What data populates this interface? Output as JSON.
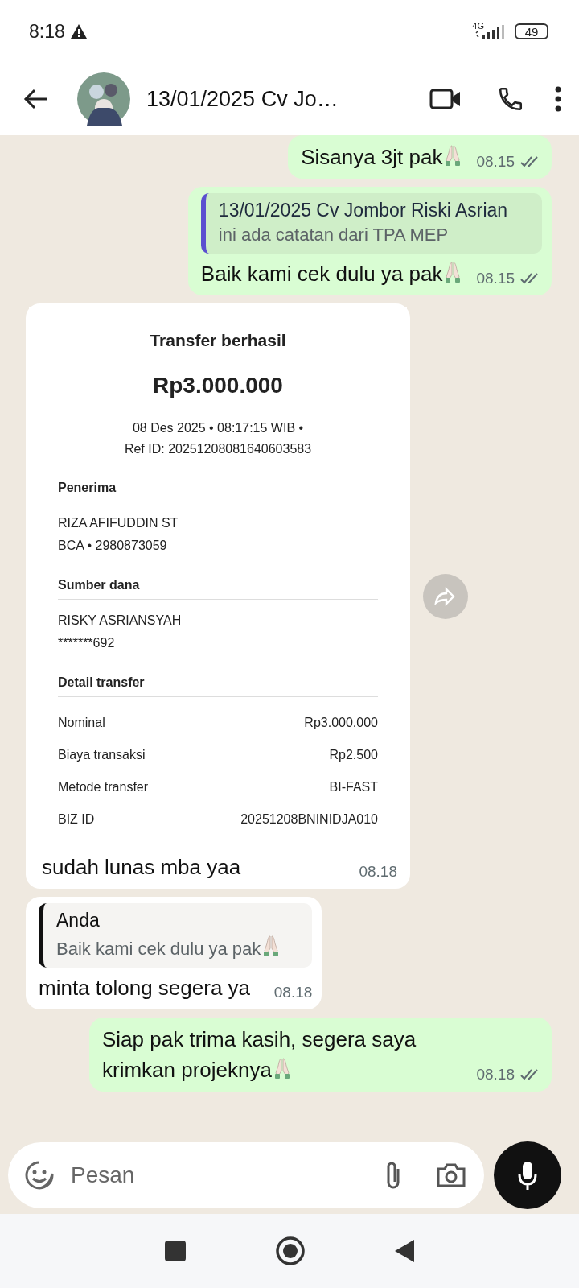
{
  "status_bar": {
    "time": "8:18",
    "network": "4G",
    "battery": "49"
  },
  "header": {
    "title": "13/01/2025 Cv Jo…"
  },
  "messages": [
    {
      "kind": "text",
      "outgoing": true,
      "text": "Sisanya 3jt pak",
      "emoji": true,
      "time": "08.15",
      "read": false
    },
    {
      "kind": "text",
      "outgoing": true,
      "quote": {
        "author": "13/01/2025 Cv Jombor Riski Asrian",
        "text": "ini ada catatan dari TPA MEP",
        "emoji": false,
        "color": "#5b4fd0"
      },
      "text": "Baik kami cek dulu ya pak",
      "emoji": true,
      "time": "08.15",
      "read": false
    },
    {
      "kind": "image",
      "outgoing": false,
      "receipt": {
        "title": "Transfer berhasil",
        "amount": "Rp3.000.000",
        "datetime": "08 Des 2025 • 08:17:15 WIB •",
        "ref": "Ref ID: 20251208081640603583",
        "sections": [
          {
            "heading": "Penerima",
            "lines": [
              "RIZA AFIFUDDIN ST",
              "BCA • 2980873059"
            ]
          },
          {
            "heading": "Sumber dana",
            "lines": [
              "RISKY ASRIANSYAH",
              "*******692"
            ]
          },
          {
            "heading": "Detail transfer",
            "rows": [
              {
                "label": "Nominal",
                "value": "Rp3.000.000"
              },
              {
                "label": "Biaya transaksi",
                "value": "Rp2.500"
              },
              {
                "label": "Metode transfer",
                "value": "BI-FAST"
              },
              {
                "label": "BIZ ID",
                "value": "20251208BNINIDJA010"
              }
            ]
          }
        ]
      },
      "caption": "sudah lunas mba yaa",
      "time": "08.18"
    },
    {
      "kind": "text",
      "outgoing": false,
      "quote": {
        "author": "Anda",
        "text": "Baik kami cek dulu ya pak",
        "emoji": true,
        "color": "#111111"
      },
      "text": "minta tolong segera ya",
      "emoji": false,
      "time": "08.18"
    },
    {
      "kind": "text",
      "outgoing": true,
      "text": "Siap pak trima kasih, segera saya krimkan projeknya",
      "emoji": true,
      "time": "08.18",
      "read": false
    }
  ],
  "composer": {
    "placeholder": "Pesan"
  }
}
